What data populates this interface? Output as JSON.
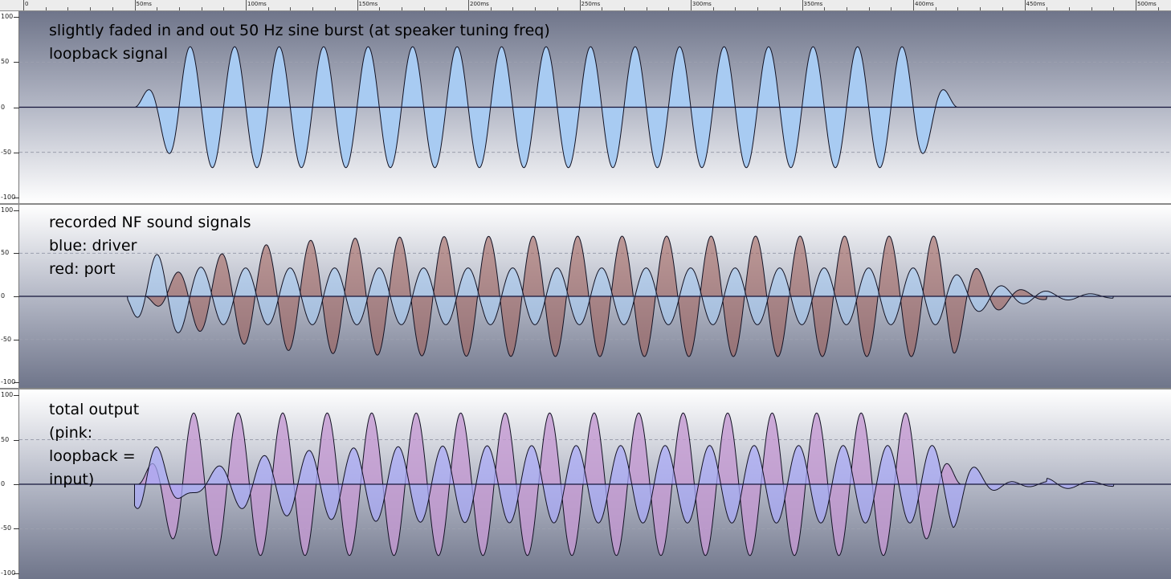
{
  "ruler": {
    "ticks": [
      {
        "t": 0,
        "label": "0"
      },
      {
        "t": 50,
        "label": "50ms"
      },
      {
        "t": 100,
        "label": "100ms"
      },
      {
        "t": 150,
        "label": "150ms"
      },
      {
        "t": 200,
        "label": "200ms"
      },
      {
        "t": 250,
        "label": "250ms"
      },
      {
        "t": 300,
        "label": "300ms"
      },
      {
        "t": 350,
        "label": "350ms"
      },
      {
        "t": 400,
        "label": "400ms"
      },
      {
        "t": 450,
        "label": "450ms"
      },
      {
        "t": 500,
        "label": "500ms"
      }
    ]
  },
  "panels": [
    {
      "label_lines": [
        "slightly faded in and out 50 Hz sine burst (at speaker tuning freq)",
        "loopback signal"
      ]
    },
    {
      "label_lines": [
        "recorded NF sound signals",
        "blue: driver",
        "red: port"
      ]
    },
    {
      "label_lines": [
        "total output",
        "(pink:",
        "loopback =",
        "input)"
      ]
    }
  ],
  "colors": {
    "bg_top": "#ffffff",
    "bg_mid": "#b4b8c6",
    "bg_dark": "#6f758a",
    "loopback_fill": "#a8cbf2",
    "driver_fill": "#a9cdf3",
    "port_fill": "#a0605a",
    "total_fill": "#aaaaf8",
    "pink_fill": "#c49ad2",
    "outline": "#111122"
  },
  "chart_data": {
    "type": "line",
    "x_unit": "ms",
    "xlim": [
      0,
      512
    ],
    "y_ticks": [
      100,
      50,
      0,
      -50,
      -100
    ],
    "signal": {
      "frequency_hz": 50,
      "start_ms": 50,
      "end_ms": 420
    },
    "series": [
      {
        "name": "loopback signal",
        "panel": 0,
        "amplitude": 67,
        "start_ms": 50,
        "end_ms": 420,
        "fade_ms": 20
      },
      {
        "name": "driver",
        "panel": 1,
        "amplitude": 33,
        "start_ms": 47,
        "end_ms": 490,
        "peak_ms": 60,
        "overshoot": 55
      },
      {
        "name": "port",
        "panel": 1,
        "amplitude": 70,
        "start_ms": 55,
        "end_ms": 460,
        "ramp_ms": 75
      },
      {
        "name": "total output",
        "panel": 2,
        "amplitude": 84,
        "start_ms": 52,
        "end_ms": 490
      },
      {
        "name": "loopback = input",
        "panel": 2,
        "amplitude": 80,
        "start_ms": 50,
        "end_ms": 420
      }
    ]
  }
}
